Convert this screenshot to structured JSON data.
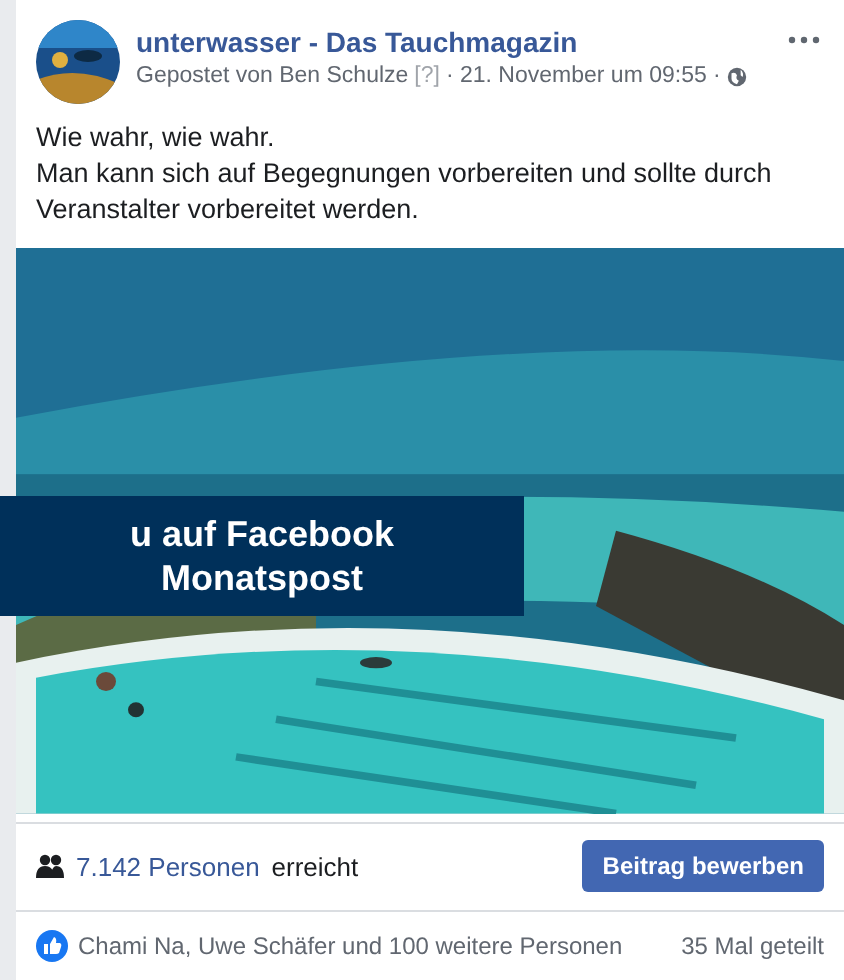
{
  "post": {
    "page_name": "unterwasser - Das Tauchmagazin",
    "posted_by": "Gepostet von Ben Schulze",
    "help_mark": "[?]",
    "date": "· 21. November um 09:55 ·",
    "text_lines": [
      "Wie wahr, wie wahr.",
      "Man kann sich auf Begegnungen vorbereiten und sollte durch",
      "Veranstalter vorbereitet werden."
    ]
  },
  "overlay": {
    "lines": [
      "u auf Facebook",
      "Monatspost"
    ]
  },
  "reach": {
    "count": "7.142 Personen",
    "suffix": "erreicht",
    "button": "Beitrag bewerben"
  },
  "reactions": {
    "names": "Chami Na, Uwe Schäfer und 100 weitere Personen",
    "shares": "35 Mal geteilt"
  }
}
